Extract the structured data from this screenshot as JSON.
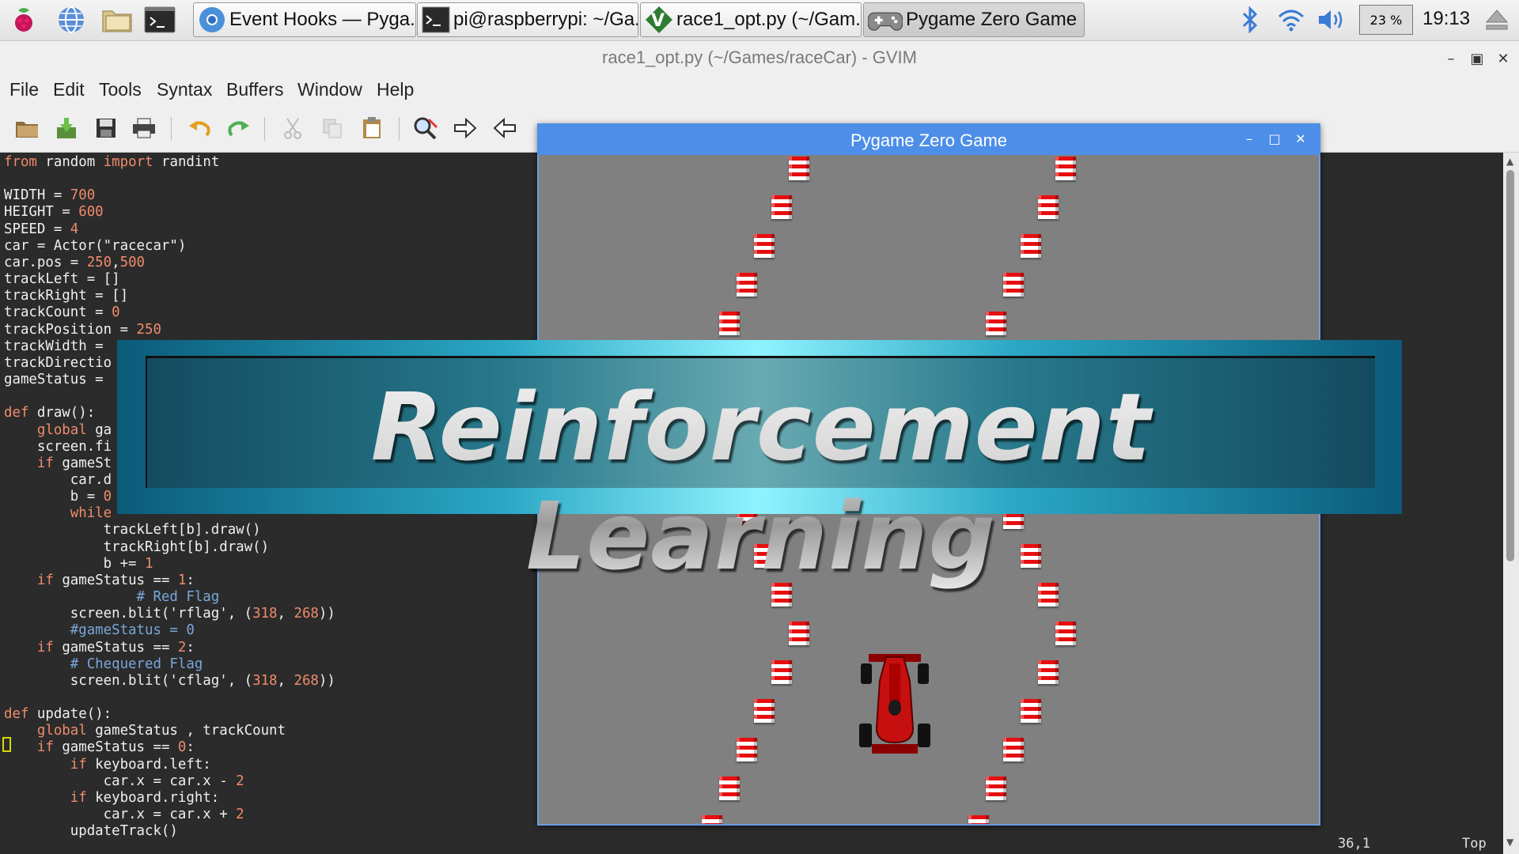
{
  "taskbar": {
    "tasks": [
      {
        "label": "Event Hooks — Pyga...",
        "icon": "chromium-icon"
      },
      {
        "label": "pi@raspberrypi: ~/Ga...",
        "icon": "terminal-icon"
      },
      {
        "label": "race1_opt.py (~/Gam...",
        "icon": "vim-icon"
      },
      {
        "label": "Pygame Zero Game",
        "icon": "gamepad-icon"
      }
    ],
    "cpu_label": "23 %",
    "clock": "19:13"
  },
  "gvim": {
    "title": "race1_opt.py (~/Games/raceCar) - GVIM",
    "menu": [
      "File",
      "Edit",
      "Tools",
      "Syntax",
      "Buffers",
      "Window",
      "Help"
    ],
    "status_position": "36,1",
    "status_scroll": "Top"
  },
  "code_lines": [
    "from random import randint",
    "",
    "WIDTH = 700",
    "HEIGHT = 600",
    "SPEED = 4",
    "car = Actor(\"racecar\")",
    "car.pos = 250,500",
    "trackLeft = []",
    "trackRight = []",
    "trackCount = 0",
    "trackPosition = 250",
    "trackWidth =",
    "trackDirectio     False",
    "gameStatus =",
    "",
    "def draw():",
    "    global ga    tatus",
    "    screen.fi   (128,128",
    "    if gameSt    s == 0:",
    "        car.d     ()",
    "        b = 0",
    "        while",
    "            trackLeft[b].draw()",
    "            trackRight[b].draw()",
    "            b += 1",
    "    if gameStatus == 1:",
    "        # Red Flag",
    "        screen.blit('rflag', (318, 268))",
    "        #gameStatus = 0",
    "    if gameStatus == 2:",
    "        # Chequered Flag",
    "        screen.blit('cflag', (318, 268))",
    "",
    "def update():",
    "    global gameStatus , trackCount",
    "    if gameStatus == 0:",
    "        if keyboard.left:",
    "            car.x = car.x - 2",
    "        if keyboard.right:",
    "            car.x = car.x + 2",
    "        updateTrack()"
  ],
  "pygame": {
    "title": "Pygame Zero Game"
  },
  "banner": {
    "text": "Reinforcement Learning"
  },
  "colors": {
    "pygame_titlebar": "#4d8fe8",
    "track_bg": "#808080",
    "banner_teal": "#2aa7c4",
    "editor_bg": "#2b2b2b"
  }
}
